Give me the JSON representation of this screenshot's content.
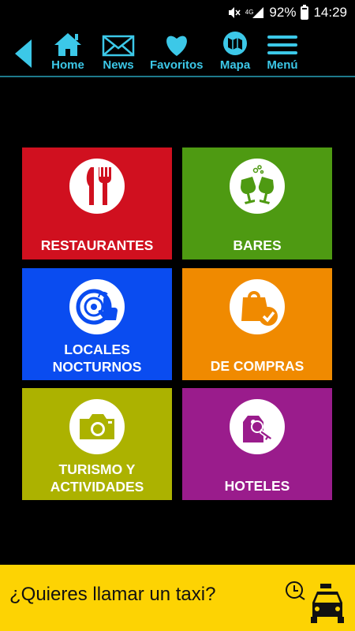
{
  "status_bar": {
    "network": "4G",
    "battery": "92%",
    "time": "14:29"
  },
  "nav": {
    "items": [
      {
        "label": "Home",
        "icon": "home-icon"
      },
      {
        "label": "News",
        "icon": "envelope-icon"
      },
      {
        "label": "Favoritos",
        "icon": "heart-icon"
      },
      {
        "label": "Mapa",
        "icon": "map-icon"
      },
      {
        "label": "Menú",
        "icon": "hamburger-icon"
      }
    ],
    "accent": "#3cc8e8"
  },
  "tiles": [
    {
      "label": "RESTAURANTES",
      "color": "#d0101f",
      "icon": "fork-knife-icon"
    },
    {
      "label": "BARES",
      "color": "#4e9a12",
      "icon": "wine-glasses-icon"
    },
    {
      "label": "LOCALES\nNOCTURNOS",
      "color": "#0a4cf0",
      "icon": "vinyl-record-icon"
    },
    {
      "label": "DE COMPRAS",
      "color": "#f08a00",
      "icon": "shopping-bag-icon"
    },
    {
      "label": "TURISMO Y\nACTIVIDADES",
      "color": "#acb200",
      "icon": "camera-icon"
    },
    {
      "label": "HOTELES",
      "color": "#9a1c8c",
      "icon": "hotel-key-icon"
    }
  ],
  "taxi": {
    "text": "¿Quieres llamar un taxi?",
    "color": "#fdd303",
    "icon": "taxi-icon"
  }
}
